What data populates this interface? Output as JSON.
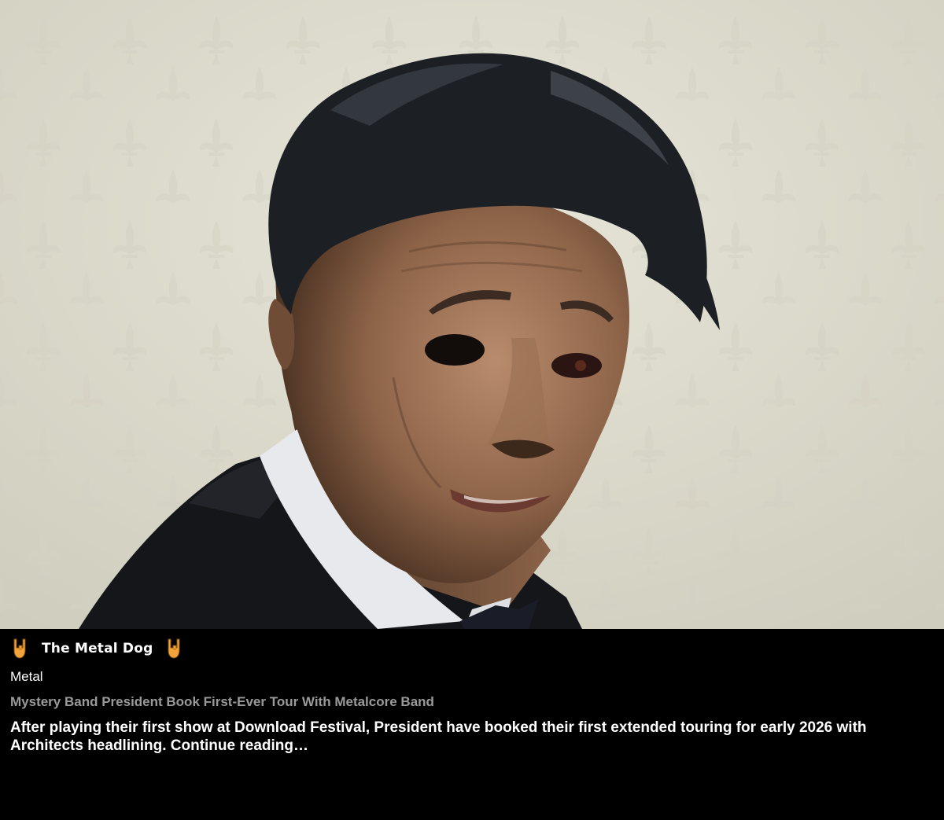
{
  "hero": {
    "icon": "photo-of-man-in-tuxedo-with-mask"
  },
  "source": {
    "name": "The Metal Dog",
    "icon": "rock-horns-hand-icon"
  },
  "category": "Metal",
  "article": {
    "headline": "Mystery Band President Book First-Ever Tour With Metalcore Band",
    "summary": "After playing their first show at Download Festival, President have booked their first extended touring for early 2026 with Architects headlining.",
    "continue_label": "Continue reading…"
  },
  "colors": {
    "background": "#000000",
    "text": "#ffffff",
    "headline": "#9a9a9a",
    "horns": "#f2a43a"
  }
}
